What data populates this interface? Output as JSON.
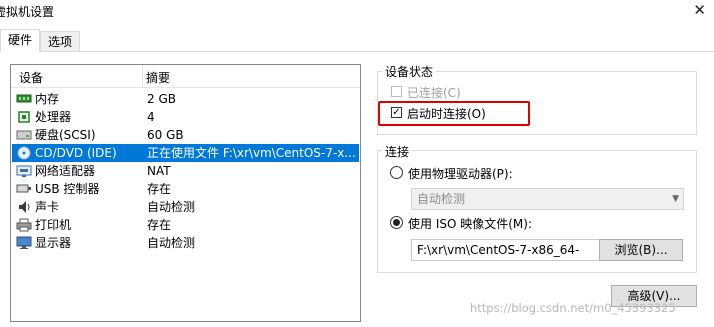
{
  "window": {
    "title": "虚拟机设置"
  },
  "tabs": [
    {
      "label": "硬件"
    },
    {
      "label": "选项"
    }
  ],
  "device_table": {
    "headers": {
      "device": "设备",
      "summary": "摘要"
    },
    "rows": [
      {
        "device": "内存",
        "summary": "2 GB",
        "icon": "memory-icon"
      },
      {
        "device": "处理器",
        "summary": "4",
        "icon": "processor-icon"
      },
      {
        "device": "硬盘(SCSI)",
        "summary": "60 GB",
        "icon": "hard-disk-icon"
      },
      {
        "device": "CD/DVD (IDE)",
        "summary": "正在使用文件 F:\\xr\\vm\\CentOS-7-x...",
        "icon": "cd-dvd-icon",
        "selected": true
      },
      {
        "device": "网络适配器",
        "summary": "NAT",
        "icon": "network-adapter-icon"
      },
      {
        "device": "USB 控制器",
        "summary": "存在",
        "icon": "usb-icon"
      },
      {
        "device": "声卡",
        "summary": "自动检测",
        "icon": "sound-card-icon"
      },
      {
        "device": "打印机",
        "summary": "存在",
        "icon": "printer-icon"
      },
      {
        "device": "显示器",
        "summary": "自动检测",
        "icon": "display-icon"
      }
    ]
  },
  "device_status": {
    "label": "设备状态",
    "connected": {
      "label": "已连接(C)",
      "checked": false,
      "enabled": false
    },
    "connect_at_power_on": {
      "label": "启动时连接(O)",
      "checked": true,
      "enabled": true
    }
  },
  "connection": {
    "label": "连接",
    "physical_drive": {
      "label": "使用物理驱动器(P):",
      "selected": false,
      "dropdown_value": "自动检测"
    },
    "iso": {
      "label": "使用 ISO 映像文件(M):",
      "selected": true,
      "path": "F:\\xr\\vm\\CentOS-7-x86_64-"
    },
    "browse_label": "浏览(B)..."
  },
  "advanced_label": "高级(V)...",
  "watermark": "https://blog.csdn.net/m0_45393325",
  "colors": {
    "selection": "#0078d7",
    "highlight_box": "#e00000"
  }
}
